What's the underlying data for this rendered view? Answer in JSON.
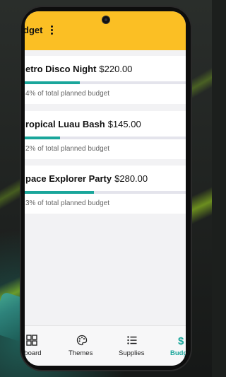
{
  "appbar": {
    "title": "dget"
  },
  "colors": {
    "accent": "#fbbf24",
    "progress": "#1aa69b",
    "track": "#e4e4ec"
  },
  "budgets": [
    {
      "name": "etro Disco Night",
      "amount": "$220.00",
      "percent_text": "4% of total planned budget",
      "fill_fraction": 0.34
    },
    {
      "name": "ropical Luau Bash",
      "amount": "$145.00",
      "percent_text": "2% of total planned budget",
      "fill_fraction": 0.22
    },
    {
      "name": "pace Explorer Party",
      "amount": "$280.00",
      "percent_text": "3% of total planned budget",
      "fill_fraction": 0.43
    }
  ],
  "nav": [
    {
      "label": "nboard",
      "icon": "dashboard-grid-icon",
      "active": false
    },
    {
      "label": "Themes",
      "icon": "palette-icon",
      "active": false
    },
    {
      "label": "Supplies",
      "icon": "list-icon",
      "active": false
    },
    {
      "label": "Budg",
      "icon": "dollar-icon",
      "active": true
    }
  ]
}
